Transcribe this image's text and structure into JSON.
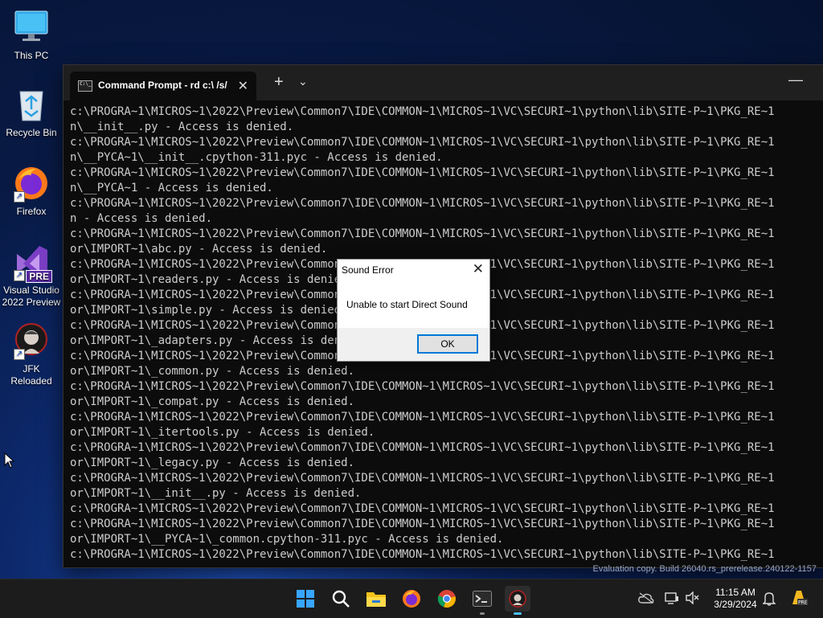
{
  "desktop": {
    "icons": [
      {
        "label": "This PC"
      },
      {
        "label": "Recycle Bin"
      },
      {
        "label": "Firefox"
      },
      {
        "label": "Visual Studio 2022 Preview",
        "badge": "PRE"
      },
      {
        "label": "JFK Reloaded"
      }
    ]
  },
  "terminal": {
    "tab_title": "Command Prompt - rd  c:\\ /s/",
    "new_tab_label": "+",
    "lines": [
      "c:\\PROGRA~1\\MICROS~1\\2022\\Preview\\Common7\\IDE\\COMMON~1\\MICROS~1\\VC\\SECURI~1\\python\\lib\\SITE-P~1\\PKG_RE~1",
      "n\\__init__.py - Access is denied.",
      "c:\\PROGRA~1\\MICROS~1\\2022\\Preview\\Common7\\IDE\\COMMON~1\\MICROS~1\\VC\\SECURI~1\\python\\lib\\SITE-P~1\\PKG_RE~1",
      "n\\__PYCA~1\\__init__.cpython-311.pyc - Access is denied.",
      "c:\\PROGRA~1\\MICROS~1\\2022\\Preview\\Common7\\IDE\\COMMON~1\\MICROS~1\\VC\\SECURI~1\\python\\lib\\SITE-P~1\\PKG_RE~1",
      "n\\__PYCA~1 - Access is denied.",
      "c:\\PROGRA~1\\MICROS~1\\2022\\Preview\\Common7\\IDE\\COMMON~1\\MICROS~1\\VC\\SECURI~1\\python\\lib\\SITE-P~1\\PKG_RE~1",
      "n - Access is denied.",
      "c:\\PROGRA~1\\MICROS~1\\2022\\Preview\\Common7\\IDE\\COMMON~1\\MICROS~1\\VC\\SECURI~1\\python\\lib\\SITE-P~1\\PKG_RE~1",
      "or\\IMPORT~1\\abc.py - Access is denied.",
      "c:\\PROGRA~1\\MICROS~1\\2022\\Preview\\Common7\\IDE\\COMMON~1\\MICROS~1\\VC\\SECURI~1\\python\\lib\\SITE-P~1\\PKG_RE~1",
      "or\\IMPORT~1\\readers.py - Access is denied.",
      "c:\\PROGRA~1\\MICROS~1\\2022\\Preview\\Common7\\IDE\\COMMON~1\\MICROS~1\\VC\\SECURI~1\\python\\lib\\SITE-P~1\\PKG_RE~1",
      "or\\IMPORT~1\\simple.py - Access is denied.",
      "c:\\PROGRA~1\\MICROS~1\\2022\\Preview\\Common7\\IDE\\COMMON~1\\MICROS~1\\VC\\SECURI~1\\python\\lib\\SITE-P~1\\PKG_RE~1",
      "or\\IMPORT~1\\_adapters.py - Access is denied.",
      "c:\\PROGRA~1\\MICROS~1\\2022\\Preview\\Common7\\IDE\\COMMON~1\\MICROS~1\\VC\\SECURI~1\\python\\lib\\SITE-P~1\\PKG_RE~1",
      "or\\IMPORT~1\\_common.py - Access is denied.",
      "c:\\PROGRA~1\\MICROS~1\\2022\\Preview\\Common7\\IDE\\COMMON~1\\MICROS~1\\VC\\SECURI~1\\python\\lib\\SITE-P~1\\PKG_RE~1",
      "or\\IMPORT~1\\_compat.py - Access is denied.",
      "c:\\PROGRA~1\\MICROS~1\\2022\\Preview\\Common7\\IDE\\COMMON~1\\MICROS~1\\VC\\SECURI~1\\python\\lib\\SITE-P~1\\PKG_RE~1",
      "or\\IMPORT~1\\_itertools.py - Access is denied.",
      "c:\\PROGRA~1\\MICROS~1\\2022\\Preview\\Common7\\IDE\\COMMON~1\\MICROS~1\\VC\\SECURI~1\\python\\lib\\SITE-P~1\\PKG_RE~1",
      "or\\IMPORT~1\\_legacy.py - Access is denied.",
      "c:\\PROGRA~1\\MICROS~1\\2022\\Preview\\Common7\\IDE\\COMMON~1\\MICROS~1\\VC\\SECURI~1\\python\\lib\\SITE-P~1\\PKG_RE~1",
      "or\\IMPORT~1\\__init__.py - Access is denied.",
      "c:\\PROGRA~1\\MICROS~1\\2022\\Preview\\Common7\\IDE\\COMMON~1\\MICROS~1\\VC\\SECURI~1\\python\\lib\\SITE-P~1\\PKG_RE~1",
      "c:\\PROGRA~1\\MICROS~1\\2022\\Preview\\Common7\\IDE\\COMMON~1\\MICROS~1\\VC\\SECURI~1\\python\\lib\\SITE-P~1\\PKG_RE~1",
      "or\\IMPORT~1\\__PYCA~1\\_common.cpython-311.pyc - Access is denied.",
      "c:\\PROGRA~1\\MICROS~1\\2022\\Preview\\Common7\\IDE\\COMMON~1\\MICROS~1\\VC\\SECURI~1\\python\\lib\\SITE-P~1\\PKG_RE~1"
    ]
  },
  "dialog": {
    "title": "Sound Error",
    "message": "Unable to start Direct Sound",
    "ok_label": "OK"
  },
  "watermark": "Evaluation copy. Build 26040.rs_prerelease.240122-1157",
  "taskbar": {
    "apps": [
      {
        "icon": "windows-start-icon"
      },
      {
        "icon": "search-icon"
      },
      {
        "icon": "file-explorer-icon"
      },
      {
        "icon": "firefox-icon"
      },
      {
        "icon": "chrome-icon"
      },
      {
        "icon": "terminal-icon"
      },
      {
        "icon": "jfk-reloaded-icon"
      }
    ],
    "time": "11:15 AM",
    "date": "3/29/2024",
    "colors": {
      "accent": "#4cc2ff",
      "taskbar_bg": "#1c1c1c",
      "dialog_focus": "#0078d7"
    }
  }
}
